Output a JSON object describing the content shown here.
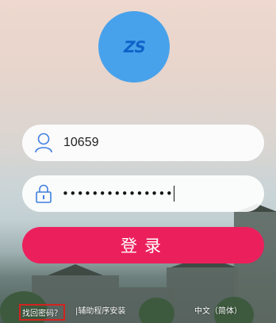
{
  "avatar": {
    "mark_text": "ZS",
    "color": "#48a2eb"
  },
  "username": {
    "value": "10659",
    "icon": "user-icon"
  },
  "password": {
    "masked_value": "•••••••••••••••",
    "icon": "lock-icon"
  },
  "login": {
    "label": "登录",
    "color": "#ec1f5d"
  },
  "footer": {
    "forgot_password": "找回密码？",
    "helper_install": "|辅助程序安装",
    "language": "中文（简体）"
  }
}
